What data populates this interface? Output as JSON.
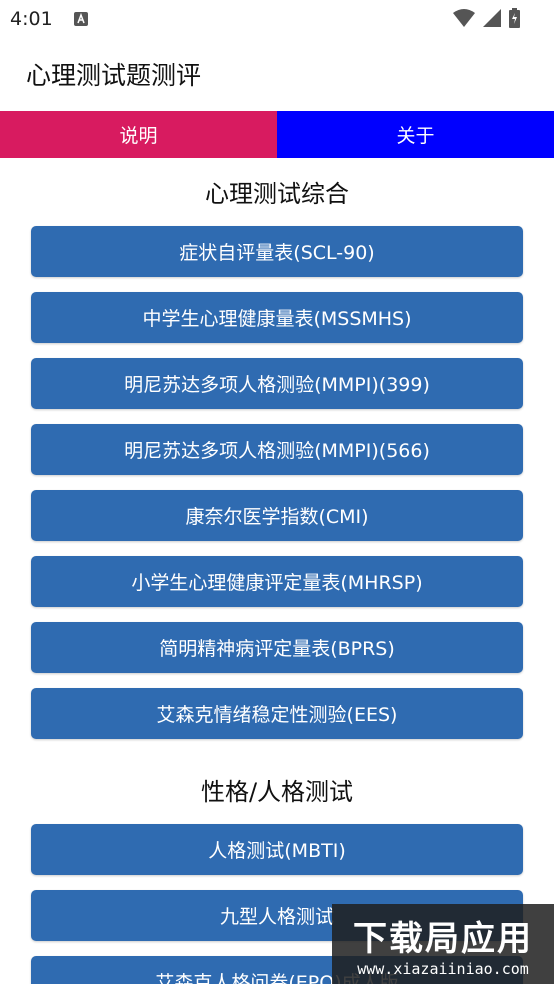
{
  "status_bar": {
    "time": "4:01"
  },
  "app": {
    "title": "心理测试题测评"
  },
  "tabs": [
    {
      "label": "说明",
      "color": "#d81b60"
    },
    {
      "label": "关于",
      "color": "#0000ff"
    }
  ],
  "sections": [
    {
      "title": "心理测试综合",
      "items": [
        "症状自评量表(SCL-90)",
        "中学生心理健康量表(MSSMHS)",
        "明尼苏达多项人格测验(MMPI)(399)",
        "明尼苏达多项人格测验(MMPI)(566)",
        "康奈尔医学指数(CMI)",
        "小学生心理健康评定量表(MHRSP)",
        "简明精神病评定量表(BPRS)",
        "艾森克情绪稳定性测验(EES)"
      ]
    },
    {
      "title": "性格/人格测试",
      "items": [
        "人格测试(MBTI)",
        "九型人格测试",
        "艾森克人格问卷(EPQ)成人版"
      ]
    }
  ],
  "watermark": {
    "main": "下载局应用",
    "sub": "www.xiazaiiniao.com"
  },
  "colors": {
    "button": "#2f6bb1",
    "text_white": "#ffffff"
  }
}
